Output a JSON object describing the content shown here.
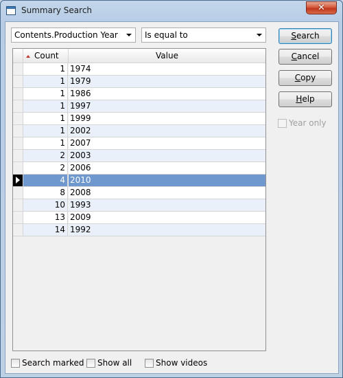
{
  "window": {
    "title": "Summary Search",
    "close_glyph": "✕"
  },
  "filters": {
    "field": "Contents.Production Year",
    "operator": "Is equal to"
  },
  "buttons": {
    "search": "Search",
    "cancel": "Cancel",
    "copy": "Copy",
    "help": "Help"
  },
  "year_only": {
    "label": "Year only",
    "checked": false,
    "enabled": false
  },
  "grid": {
    "columns": [
      {
        "label": "Count",
        "sorted": "ascending"
      },
      {
        "label": "Value"
      }
    ],
    "rows": [
      {
        "count": "1",
        "value": "1974"
      },
      {
        "count": "1",
        "value": "1979"
      },
      {
        "count": "1",
        "value": "1986"
      },
      {
        "count": "1",
        "value": "1997"
      },
      {
        "count": "1",
        "value": "1999"
      },
      {
        "count": "1",
        "value": "2002"
      },
      {
        "count": "1",
        "value": "2007"
      },
      {
        "count": "2",
        "value": "2003"
      },
      {
        "count": "2",
        "value": "2006"
      },
      {
        "count": "4",
        "value": "2010",
        "current": true
      },
      {
        "count": "8",
        "value": "2008"
      },
      {
        "count": "10",
        "value": "1993"
      },
      {
        "count": "13",
        "value": "2009"
      },
      {
        "count": "14",
        "value": "1992"
      }
    ]
  },
  "options": {
    "search_marked": "Search marked",
    "show_all": "Show all",
    "show_videos": "Show videos"
  }
}
